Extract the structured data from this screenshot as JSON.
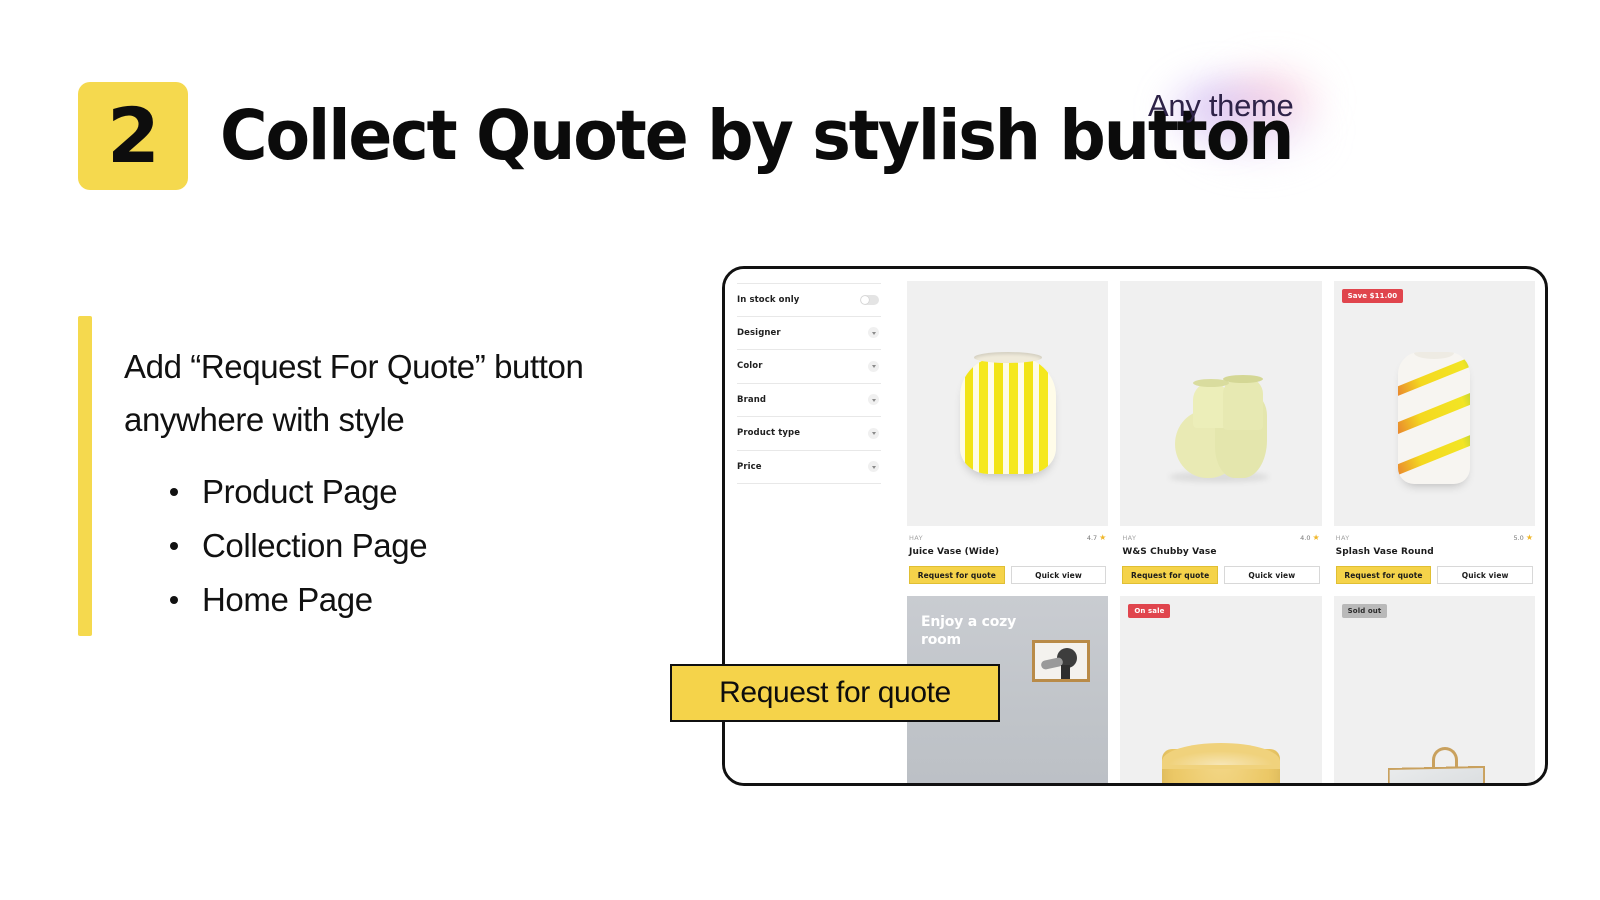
{
  "header": {
    "step_number": "2",
    "title": "Collect Quote by stylish button",
    "tagline": "Any theme",
    "accent_yellow": "#f5d94e",
    "tagline_color": "#2e2348"
  },
  "copy": {
    "lead": "Add “Request For Quote” button anywhere with style",
    "bullets": [
      {
        "label": "Product Page"
      },
      {
        "label": "Collection Page"
      },
      {
        "label": "Home Page"
      }
    ]
  },
  "callout": {
    "label": "Request for quote",
    "background": "#f5d34a",
    "border": "#101010"
  },
  "mockup": {
    "filters": [
      {
        "label": "In stock only",
        "control": "toggle",
        "state": "off"
      },
      {
        "label": "Designer",
        "control": "chevron-down-icon"
      },
      {
        "label": "Color",
        "control": "chevron-down-icon"
      },
      {
        "label": "Brand",
        "control": "chevron-down-icon"
      },
      {
        "label": "Product type",
        "control": "chevron-down-icon"
      },
      {
        "label": "Price",
        "control": "chevron-down-icon"
      }
    ],
    "buttons": {
      "request_quote": "Request for quote",
      "quick_view": "Quick view"
    },
    "products": [
      {
        "brand": "HAY",
        "name": "Juice Vase (Wide)",
        "rating": "4.7",
        "star": "★",
        "badge": null,
        "image": "yellow-striped-vase"
      },
      {
        "brand": "HAY",
        "name": "W&S Chubby Vase",
        "rating": "4.0",
        "star": "★",
        "badge": null,
        "image": "pale-green-chubby-vase"
      },
      {
        "brand": "HAY",
        "name": "Splash Vase Round",
        "rating": "5.0",
        "star": "★",
        "badge": {
          "text": "Save $11.00",
          "type": "sale",
          "color": "#e0454d"
        },
        "image": "white-marbled-swirl-vase"
      }
    ],
    "second_row": [
      {
        "image": "cozy-room-banner",
        "banner_text": "Enjoy a cozy room",
        "badge": null
      },
      {
        "image": "yellow-cushion",
        "badge": {
          "text": "On sale",
          "type": "onsale",
          "color": "#e0454d"
        }
      },
      {
        "image": "brass-strap-mirror",
        "badge": {
          "text": "Sold out",
          "type": "soldout",
          "color": "#b9b9b9"
        }
      }
    ]
  }
}
